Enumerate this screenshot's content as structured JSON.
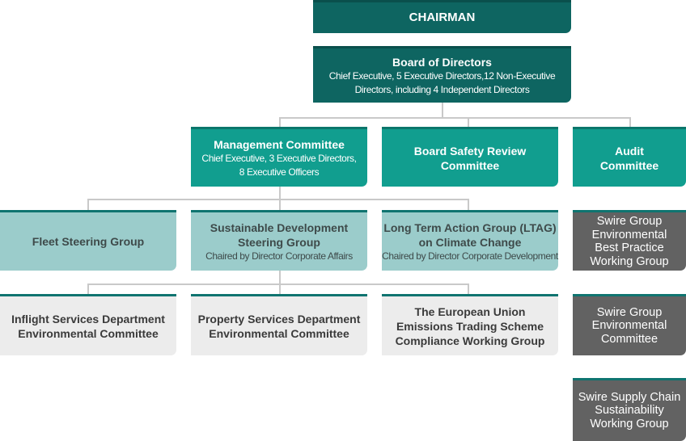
{
  "chairman": {
    "title": "CHAIRMAN"
  },
  "board": {
    "title": "Board of Directors",
    "line1": "Chief Executive, 5 Executive Directors,12 Non-Executive",
    "line2": "Directors, including 4 Independent Directors"
  },
  "management": {
    "title": "Management Committee",
    "line1": "Chief Executive, 3 Executive Directors,",
    "line2": "8 Executive Officers"
  },
  "safety": {
    "line1": "Board Safety Review",
    "line2": "Committee"
  },
  "audit": {
    "line1": "Audit",
    "line2": "Committee"
  },
  "fleet": {
    "title": "Fleet Steering Group"
  },
  "sustainable": {
    "line1": "Sustainable Development",
    "line2": "Steering Group",
    "sub": "Chaired by Director Corporate Affairs"
  },
  "ltag": {
    "line1": "Long Term Action Group (LTAG)",
    "line2": "on Climate Change",
    "sub": "Chaired by Director Corporate Development"
  },
  "swire_best": {
    "lines": [
      "Swire Group",
      "Environmental",
      "Best Practice",
      "Working Group"
    ]
  },
  "inflight": {
    "line1": "Inflight Services Department",
    "line2": "Environmental Committee"
  },
  "property": {
    "line1": "Property Services Department",
    "line2": "Environmental Committee"
  },
  "eu_ets": {
    "line1": "The European Union",
    "line2": "Emissions Trading Scheme",
    "line3": "Compliance Working Group"
  },
  "swire_env": {
    "lines": [
      "Swire Group",
      "Environmental",
      "Committee"
    ]
  },
  "swire_supply": {
    "lines": [
      "Swire Supply Chain",
      "Sustainability",
      "Working Group"
    ]
  },
  "colors": {
    "dark_teal": "#0e6561",
    "teal": "#119e8f",
    "light_teal": "#9bcccb",
    "pale_gray": "#ececec",
    "dark_gray": "#626262",
    "connector": "#c9c9c9"
  }
}
